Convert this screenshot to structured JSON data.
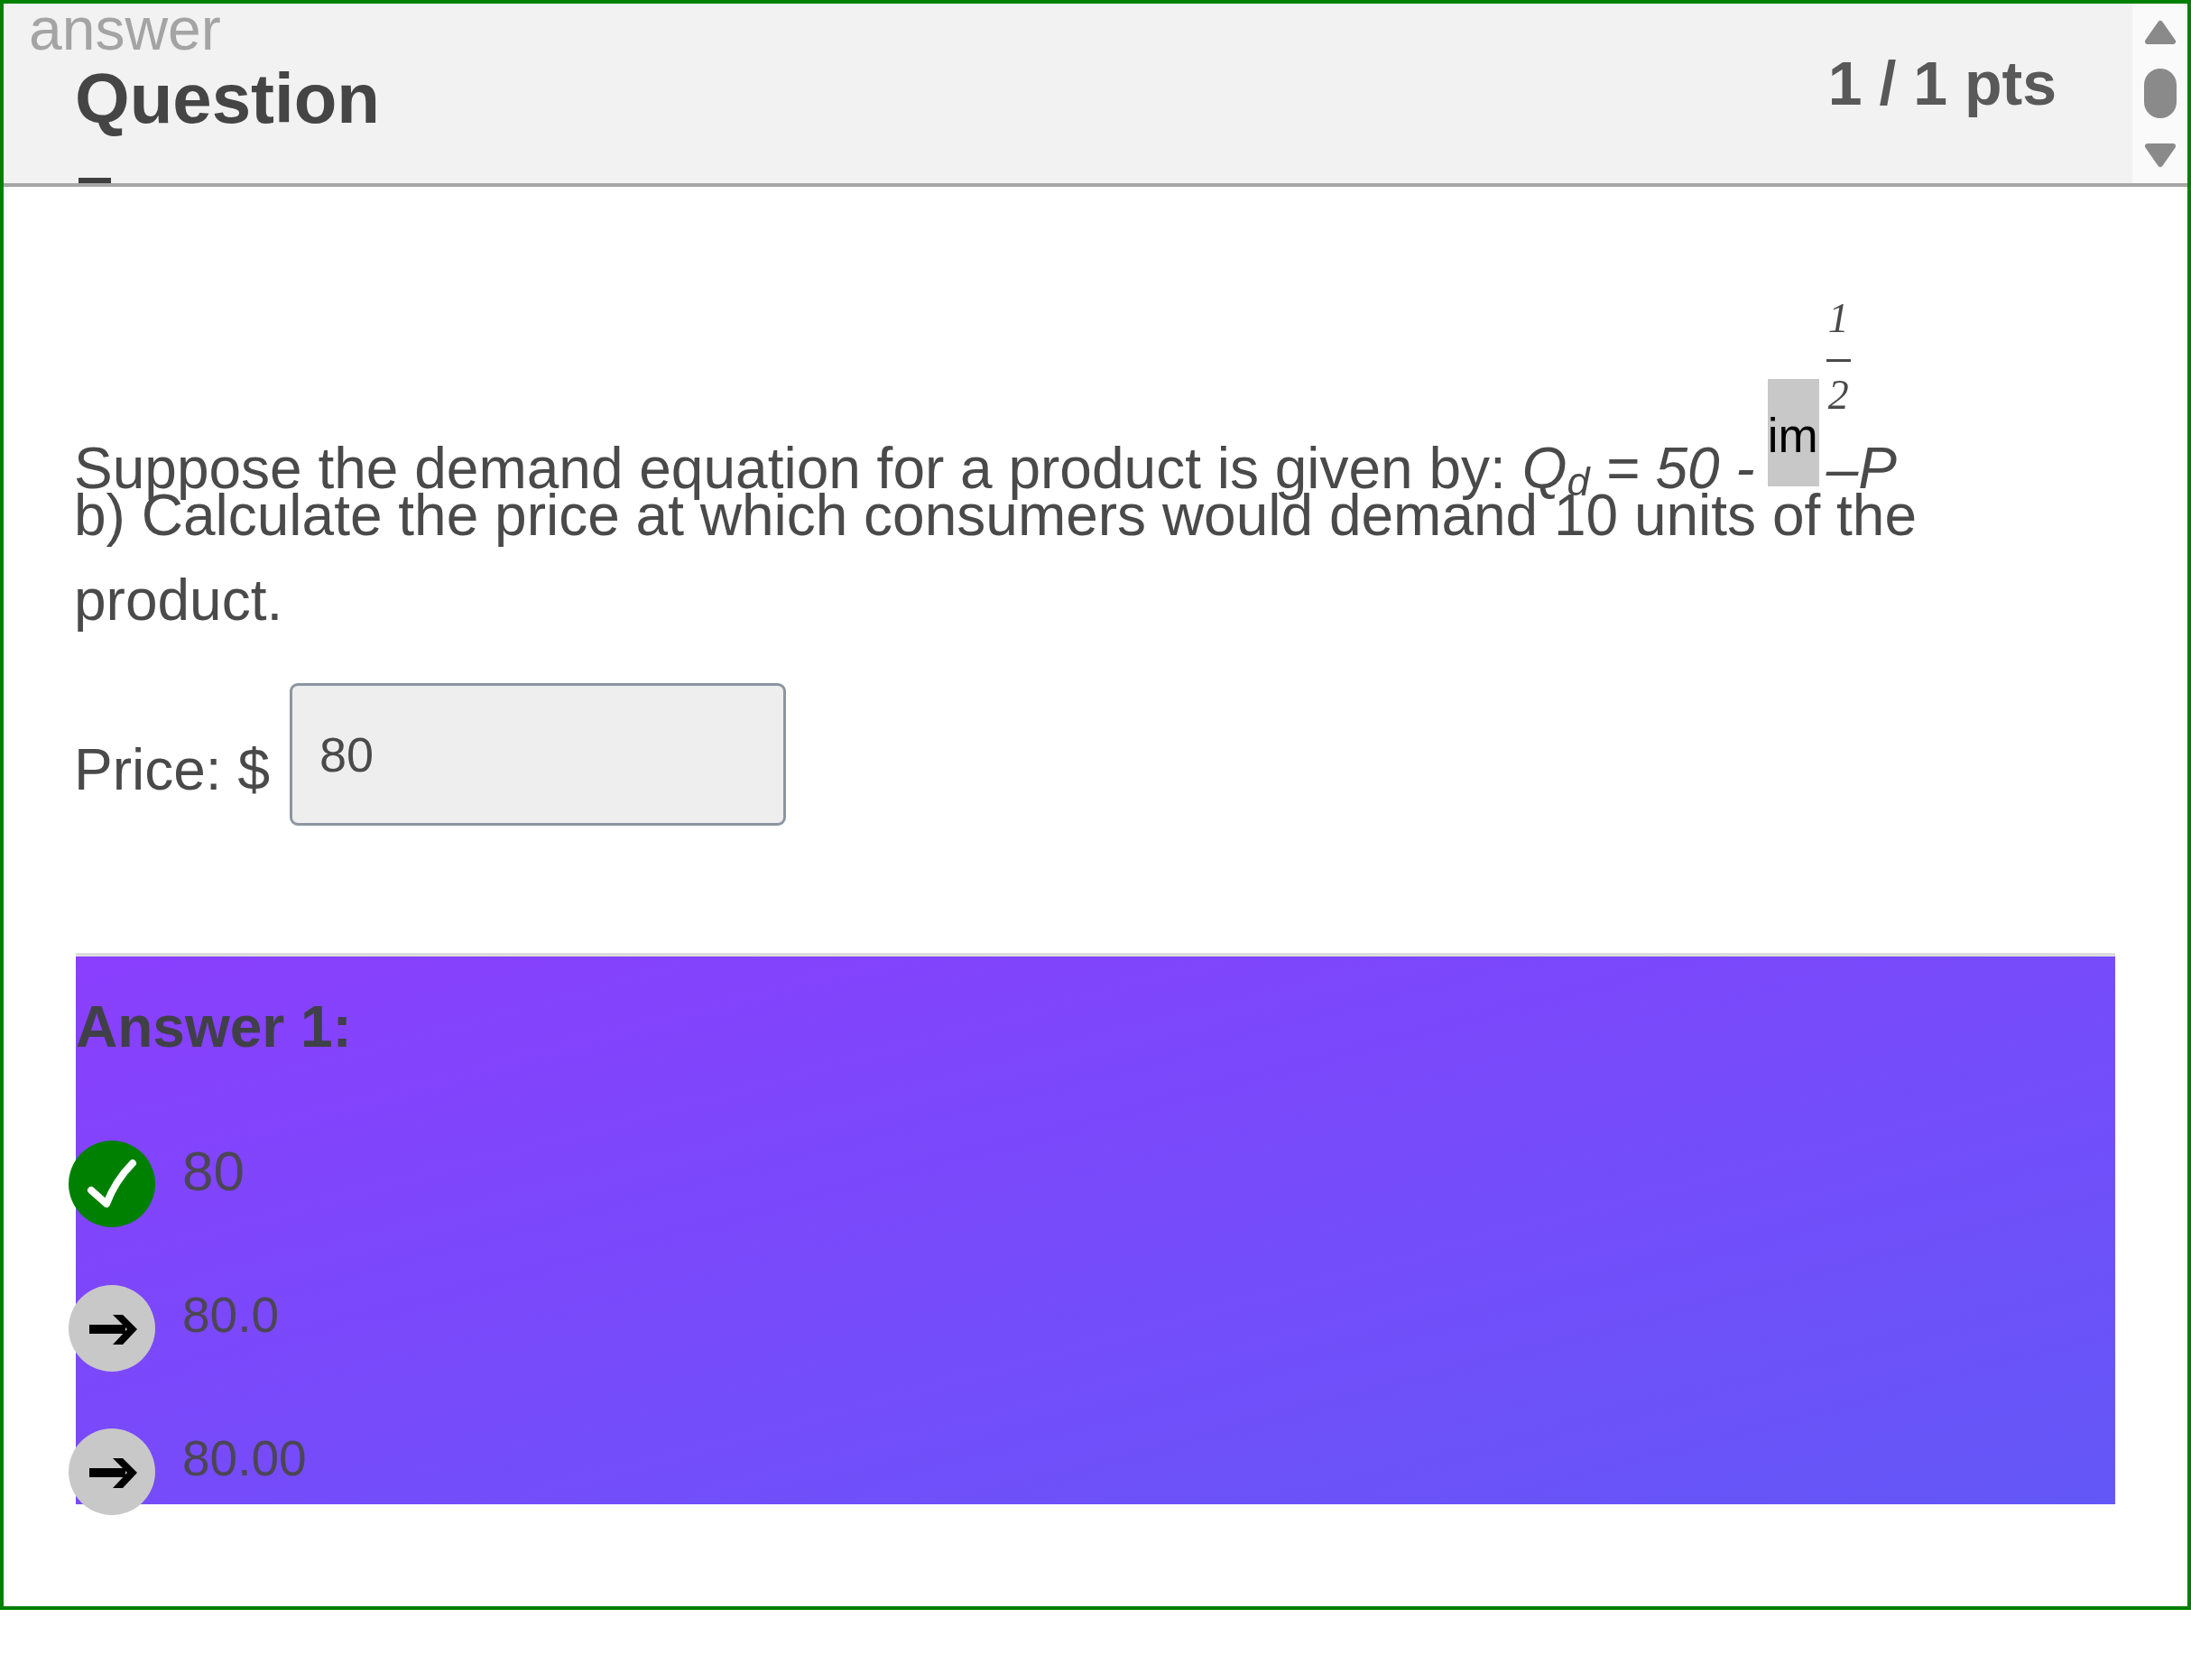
{
  "header": {
    "label": "answer",
    "title": "Question",
    "score": "1 / 1 pts"
  },
  "question": {
    "intro": "Suppose the demand equation for a product is given by: *Q*$_{d}$ *= 50 -*",
    "image_alt": "im",
    "fraction": {
      "numerator": "1",
      "denominator": "2"
    },
    "formula_tail": "–P",
    "prompt": "b) Calculate the price at which consumers would demand 10 units of the product."
  },
  "price_field": {
    "label": "Price: $",
    "value": "80"
  },
  "answer_panel": {
    "heading": "Answer 1:",
    "answers": [
      {
        "text": "80",
        "kind": "correct"
      },
      {
        "text": "80.0",
        "kind": "alternative"
      },
      {
        "text": "80.00",
        "kind": "alternative"
      }
    ]
  }
}
